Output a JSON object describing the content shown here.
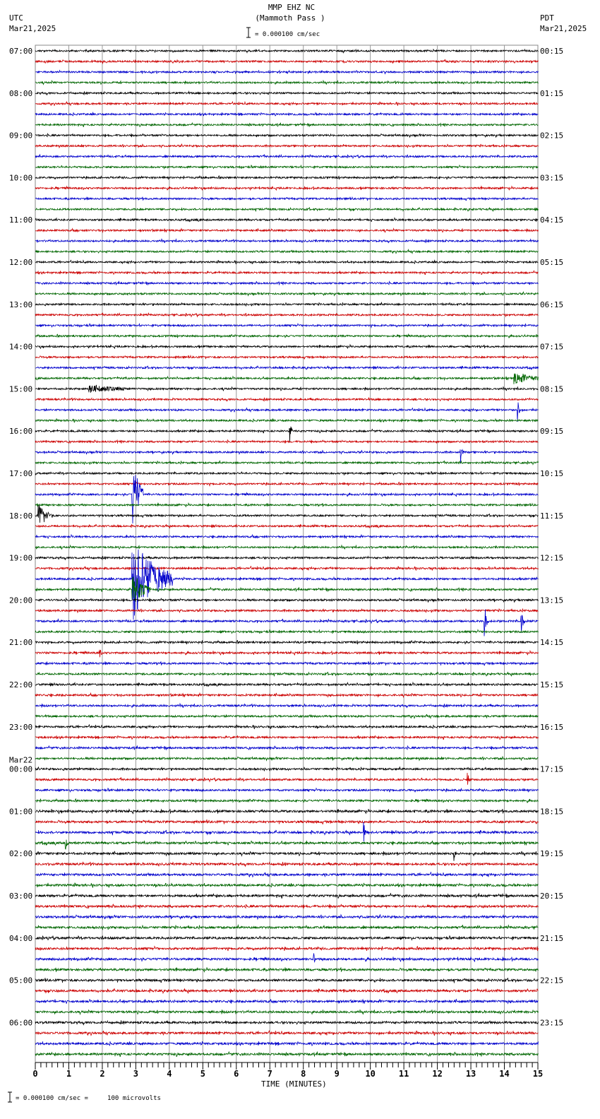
{
  "header": {
    "station": "MMP EHZ NC",
    "location": "(Mammoth Pass )",
    "scale": "= 0.000100 cm/sec",
    "left_tz": "UTC",
    "left_date": "Mar21,2025",
    "right_tz": "PDT",
    "right_date": "Mar21,2025"
  },
  "footer": {
    "scale": "= 0.000100 cm/sec =     100 microvolts",
    "mark": "A"
  },
  "chart_data": {
    "type": "line",
    "title": "MMP EHZ NC (Mammoth Pass )",
    "xlabel": "TIME (MINUTES)",
    "xlim": [
      0,
      15
    ],
    "x_ticks": [
      "0",
      "1",
      "2",
      "3",
      "4",
      "5",
      "6",
      "7",
      "8",
      "9",
      "10",
      "11",
      "12",
      "13",
      "14",
      "15"
    ],
    "traces_per_hour": 4,
    "trace_colors": [
      "#000000",
      "#cc0000",
      "#0000cc",
      "#006600"
    ],
    "left_labels": [
      "07:00",
      "08:00",
      "09:00",
      "10:00",
      "11:00",
      "12:00",
      "13:00",
      "14:00",
      "15:00",
      "16:00",
      "17:00",
      "18:00",
      "19:00",
      "20:00",
      "21:00",
      "22:00",
      "23:00",
      "00:00",
      "01:00",
      "02:00",
      "03:00",
      "04:00",
      "05:00",
      "06:00"
    ],
    "date_change_label": "Mar22",
    "date_change_index": 17,
    "right_labels": [
      "00:15",
      "01:15",
      "02:15",
      "03:15",
      "04:15",
      "05:15",
      "06:15",
      "07:15",
      "08:15",
      "09:15",
      "10:15",
      "11:15",
      "12:15",
      "13:15",
      "14:15",
      "15:15",
      "16:15",
      "17:15",
      "18:15",
      "19:15",
      "20:15",
      "21:15",
      "22:15",
      "23:15"
    ],
    "noise_by_trace_quarter": [
      1.2,
      1.2,
      1.3,
      1.5
    ],
    "events": [
      {
        "trace": 31,
        "minute": 14.3,
        "amp": 8,
        "dur": 0.8
      },
      {
        "trace": 32,
        "minute": 1.6,
        "amp": 5,
        "dur": 1.2
      },
      {
        "trace": 34,
        "minute": 14.4,
        "amp": 20,
        "dur": 0.05
      },
      {
        "trace": 36,
        "minute": 7.6,
        "amp": 16,
        "dur": 0.05
      },
      {
        "trace": 38,
        "minute": 12.7,
        "amp": 15,
        "dur": 0.05
      },
      {
        "trace": 42,
        "minute": 2.9,
        "amp": 50,
        "dur": 0.3
      },
      {
        "trace": 44,
        "minute": 0.1,
        "amp": 14,
        "dur": 0.4
      },
      {
        "trace": 50,
        "minute": 2.9,
        "amp": 60,
        "dur": 1.2
      },
      {
        "trace": 51,
        "minute": 2.9,
        "amp": 25,
        "dur": 0.5
      },
      {
        "trace": 54,
        "minute": 14.5,
        "amp": 20,
        "dur": 0.1
      },
      {
        "trace": 54,
        "minute": 13.4,
        "amp": 22,
        "dur": 0.1
      },
      {
        "trace": 57,
        "minute": 1.9,
        "amp": 10,
        "dur": 0.05
      },
      {
        "trace": 69,
        "minute": 12.9,
        "amp": 10,
        "dur": 0.05
      },
      {
        "trace": 74,
        "minute": 9.8,
        "amp": 15,
        "dur": 0.05
      },
      {
        "trace": 75,
        "minute": 0.9,
        "amp": 10,
        "dur": 0.05
      },
      {
        "trace": 76,
        "minute": 12.5,
        "amp": 10,
        "dur": 0.05
      },
      {
        "trace": 86,
        "minute": 8.3,
        "amp": 7,
        "dur": 0.05
      }
    ]
  }
}
